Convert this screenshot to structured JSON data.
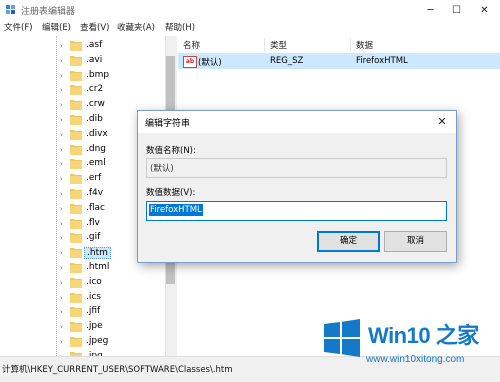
{
  "window": {
    "title": "注册表编辑器",
    "minimize_glyph": "─",
    "maximize_glyph": "☐",
    "close_glyph": "✕"
  },
  "menu": [
    "文件(F)",
    "编辑(E)",
    "查看(V)",
    "收藏夹(A)",
    "帮助(H)"
  ],
  "tree": {
    "items": [
      ".asf",
      ".avi",
      ".bmp",
      ".cr2",
      ".crw",
      ".dib",
      ".divx",
      ".dng",
      ".eml",
      ".erf",
      ".f4v",
      ".flac",
      ".flv",
      ".gif",
      ".htm",
      ".html",
      ".ico",
      ".ics",
      ".jfif",
      ".jpe",
      ".jpeg",
      ".jpg"
    ],
    "selected": ".htm",
    "expander_glyph": "›"
  },
  "values_list": {
    "columns": [
      "名称",
      "类型",
      "数据"
    ],
    "rows": [
      {
        "icon": "string-value-icon",
        "icon_text": "ab",
        "name": "(默认)",
        "type": "REG_SZ",
        "data": "FirefoxHTML"
      }
    ]
  },
  "status_bar": {
    "path": "计算机\\HKEY_CURRENT_USER\\SOFTWARE\\Classes\\.htm"
  },
  "dialog": {
    "title": "编辑字符串",
    "close_glyph": "✕",
    "name_label": "数值名称(N):",
    "name_value": "(默认)",
    "data_label": "数值数据(V):",
    "data_value": "FirefoxHTML",
    "ok_label": "确定",
    "cancel_label": "取消"
  },
  "watermark": {
    "brand": "Win10 之家",
    "url": "www.win10xitong.com"
  },
  "colors": {
    "accent": "#0078d7",
    "selection": "#cce8ff",
    "folder": "#f0c75a",
    "brand": "#1479c9"
  }
}
